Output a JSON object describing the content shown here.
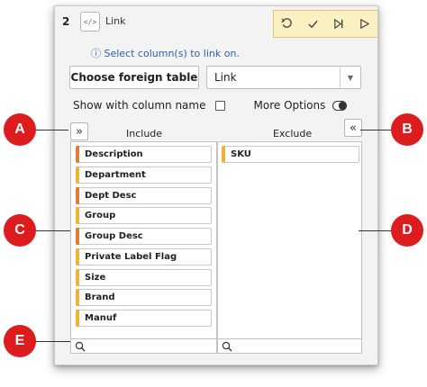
{
  "header": {
    "step_number": "2",
    "code_icon_text": "</>",
    "tool_title": "Link"
  },
  "toolbar": {
    "buttons": [
      {
        "name": "undo-icon"
      },
      {
        "name": "check-icon"
      },
      {
        "name": "step-forward-icon"
      },
      {
        "name": "play-icon"
      }
    ]
  },
  "info_text": "ⓘ Select column(s) to link on.",
  "choose_button_label": "Choose foreign table",
  "link_select_value": "Link",
  "options": {
    "show_column_name_label": "Show with column name",
    "show_column_name_checked": false,
    "more_options_label": "More Options",
    "more_options_on": true
  },
  "include": {
    "header": "Include",
    "move_button_label": "»",
    "items": [
      {
        "label": "Description",
        "color": "#e07b39"
      },
      {
        "label": "Department",
        "color": "#f0b23c"
      },
      {
        "label": "Dept Desc",
        "color": "#e07b39"
      },
      {
        "label": "Group",
        "color": "#f0b23c"
      },
      {
        "label": "Group Desc",
        "color": "#e07b39"
      },
      {
        "label": "Private Label Flag",
        "color": "#f0b23c"
      },
      {
        "label": "Size",
        "color": "#f0b23c"
      },
      {
        "label": "Brand",
        "color": "#f0b23c"
      },
      {
        "label": "Manuf",
        "color": "#f0b23c"
      }
    ]
  },
  "exclude": {
    "header": "Exclude",
    "move_button_label": "«",
    "items": [
      {
        "label": "SKU",
        "color": "#f0b23c"
      }
    ]
  },
  "callouts": [
    "A",
    "B",
    "C",
    "D",
    "E"
  ],
  "colors": {
    "callout": "#dd1d1d",
    "toolbar_bg": "#fbf0c1",
    "info_text": "#2d5fab"
  }
}
